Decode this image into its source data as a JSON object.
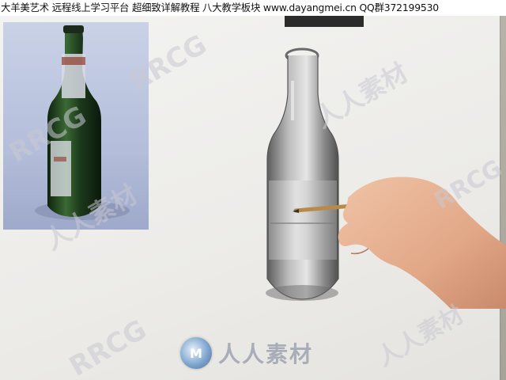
{
  "caption": {
    "text": "大羊美艺术 远程线上学习平台 超细致详解教程 八大教学板块 www.dayangmei.cn QQ群372199530"
  },
  "watermarks": {
    "brand_latin": "RRCG",
    "brand_cn": "人人素材",
    "logo_letter": "M"
  },
  "colors": {
    "bottle_green": "#1f3a1f",
    "photo_bg": "#b6c0dc",
    "paper": "#efeeeb",
    "skin": "#e2a888"
  }
}
